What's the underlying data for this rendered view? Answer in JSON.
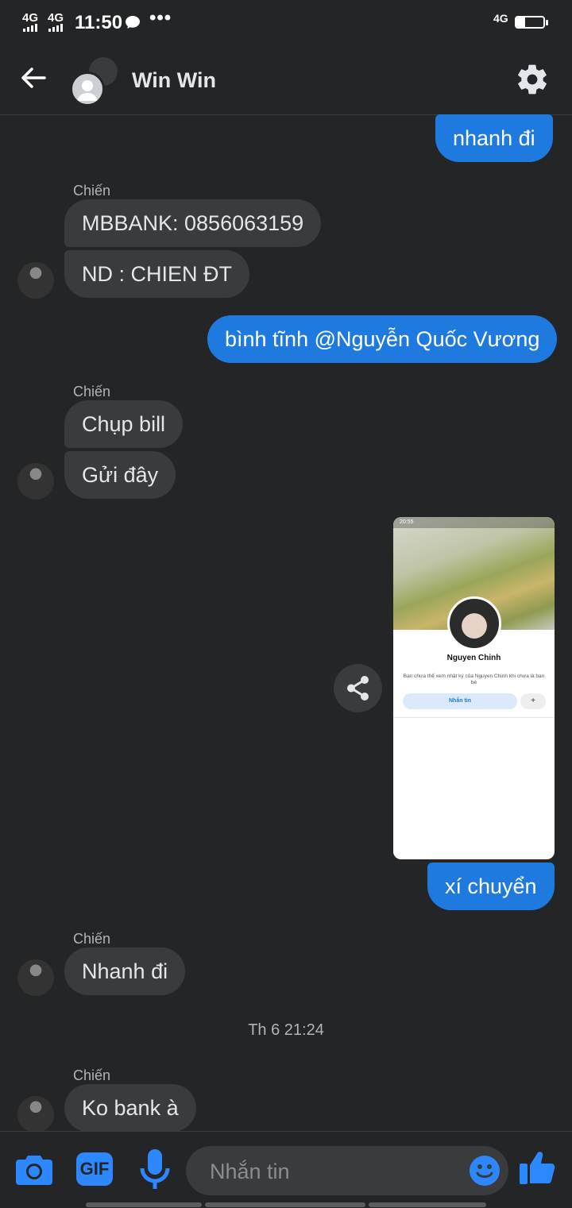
{
  "status_bar": {
    "network_1": "4G",
    "network_2": "4G",
    "time": "11:50",
    "overflow": "•••",
    "right_network": "4G",
    "battery": "33"
  },
  "header": {
    "title": "Win Win",
    "back_icon": "arrow-left-icon",
    "settings_icon": "gear-icon"
  },
  "messages": [
    {
      "direction": "out",
      "text": "nhanh đi"
    },
    {
      "direction": "in",
      "sender": "Chiến",
      "text": "MBBANK: 0856063159"
    },
    {
      "direction": "in",
      "text": "ND : CHIEN ĐT"
    },
    {
      "direction": "out",
      "text": "bình tĩnh @Nguyễn Quốc Vương"
    },
    {
      "direction": "in",
      "sender": "Chiến",
      "text": "Chụp bill"
    },
    {
      "direction": "in",
      "text": "Gửi đây"
    },
    {
      "direction": "out",
      "type": "image"
    },
    {
      "direction": "out",
      "text": "xí chuyển"
    },
    {
      "direction": "in",
      "sender": "Chiến",
      "text": "Nhanh đi"
    },
    {
      "direction": "in",
      "sender": "Chiến",
      "text": "Ko bank à"
    }
  ],
  "timestamp": "Th 6 21:24",
  "shared_image": {
    "status_time": "20:55",
    "profile_name": "Nguyen Chinh",
    "description": "Bạn chưa thể xem nhật ký của Nguyen Chinh khi chưa là bạn bè",
    "message_button": "Nhắn tin"
  },
  "composer": {
    "placeholder": "Nhắn tin",
    "icons": [
      "camera-icon",
      "gif-icon",
      "microphone-icon",
      "emoji-icon",
      "like-icon"
    ],
    "gif_label": "GIF"
  },
  "colors": {
    "background": "#242526",
    "outgoing_bubble": "#1f7ae0",
    "incoming_bubble": "#3a3b3c",
    "accent": "#1f7ae0"
  }
}
